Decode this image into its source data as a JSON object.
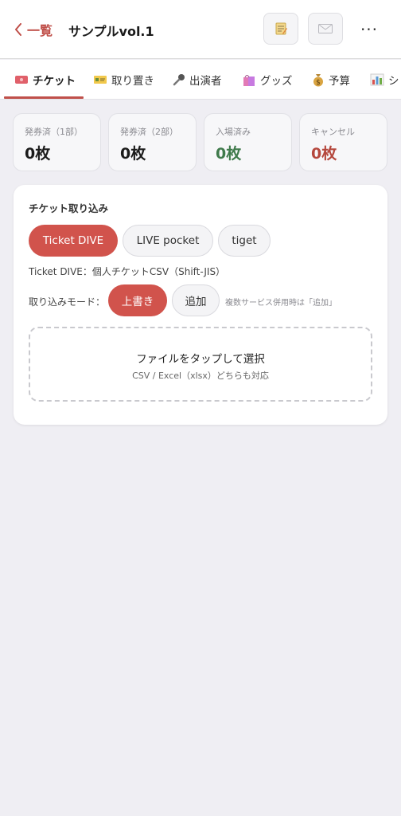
{
  "header": {
    "back_label": "一覧",
    "title": "サンプルvol.1",
    "memo_icon": "memo-icon",
    "mail_icon": "mail-icon",
    "more_label": "···"
  },
  "tabs": [
    {
      "label": "チケット",
      "icon": "ticket-icon",
      "active": true
    },
    {
      "label": "取り置き",
      "icon": "reserve-ticket-icon",
      "active": false
    },
    {
      "label": "出演者",
      "icon": "microphone-icon",
      "active": false
    },
    {
      "label": "グッズ",
      "icon": "shopping-bag-icon",
      "active": false
    },
    {
      "label": "予算",
      "icon": "money-bag-icon",
      "active": false
    },
    {
      "label": "シ",
      "icon": "bar-chart-icon",
      "active": false
    }
  ],
  "stats": [
    {
      "label": "発券済（1部）",
      "value": "0枚",
      "color": "#1b1b1b"
    },
    {
      "label": "発券済（2部）",
      "value": "0枚",
      "color": "#1b1b1b"
    },
    {
      "label": "入場済み",
      "value": "0枚",
      "color": "#3f7a4b"
    },
    {
      "label": "キャンセル",
      "value": "0枚",
      "color": "#b5473d"
    }
  ],
  "import": {
    "title": "チケット取り込み",
    "sources": [
      {
        "label": "Ticket DIVE",
        "selected": true
      },
      {
        "label": "LIVE pocket",
        "selected": false
      },
      {
        "label": "tiget",
        "selected": false
      }
    ],
    "description": "Ticket DIVE：個人チケットCSV（Shift-JIS）",
    "mode_label": "取り込みモード：",
    "modes": [
      {
        "label": "上書き",
        "selected": true
      },
      {
        "label": "追加",
        "selected": false
      }
    ],
    "mode_note": "複数サービス併用時は「追加」",
    "drop_main": "ファイルをタップして選択",
    "drop_sub": "CSV / Excel（xlsx）どちらも対応"
  },
  "colors": {
    "accent": "#d1534c",
    "green": "#3f7a4b",
    "red": "#b5473d",
    "background": "#efeef3"
  }
}
